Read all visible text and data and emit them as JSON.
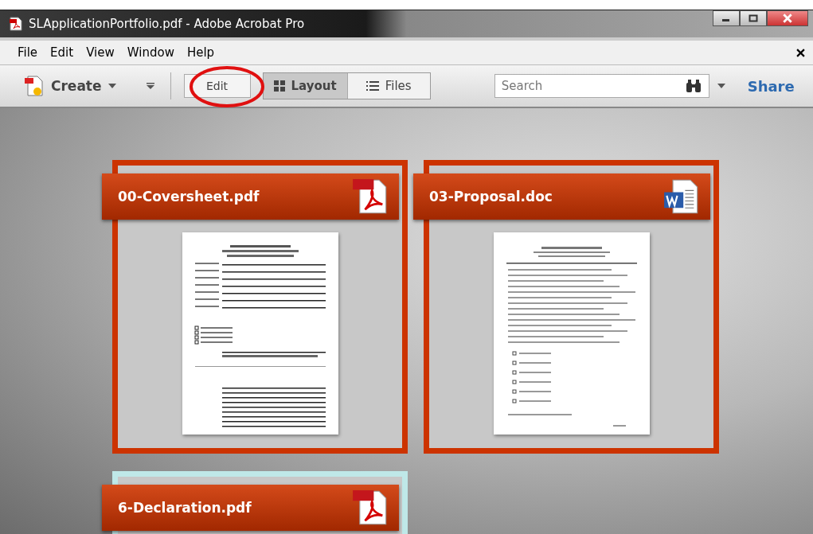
{
  "window": {
    "title": "SLApplicationPortfolio.pdf - Adobe Acrobat Pro"
  },
  "menu": [
    "File",
    "Edit",
    "View",
    "Window",
    "Help"
  ],
  "toolbar": {
    "create": "Create",
    "edit": "Edit",
    "views": [
      {
        "label": "Layout",
        "selected": true
      },
      {
        "label": "Files",
        "selected": false
      }
    ],
    "search": {
      "placeholder": "Search"
    },
    "share": "Share"
  },
  "files": [
    {
      "name": "00-Coversheet.pdf",
      "kind": "pdf",
      "selected": true
    },
    {
      "name": "03-Proposal.doc",
      "kind": "doc",
      "selected": true
    },
    {
      "name": "6-Declaration.pdf",
      "kind": "pdf",
      "selected": false
    }
  ]
}
